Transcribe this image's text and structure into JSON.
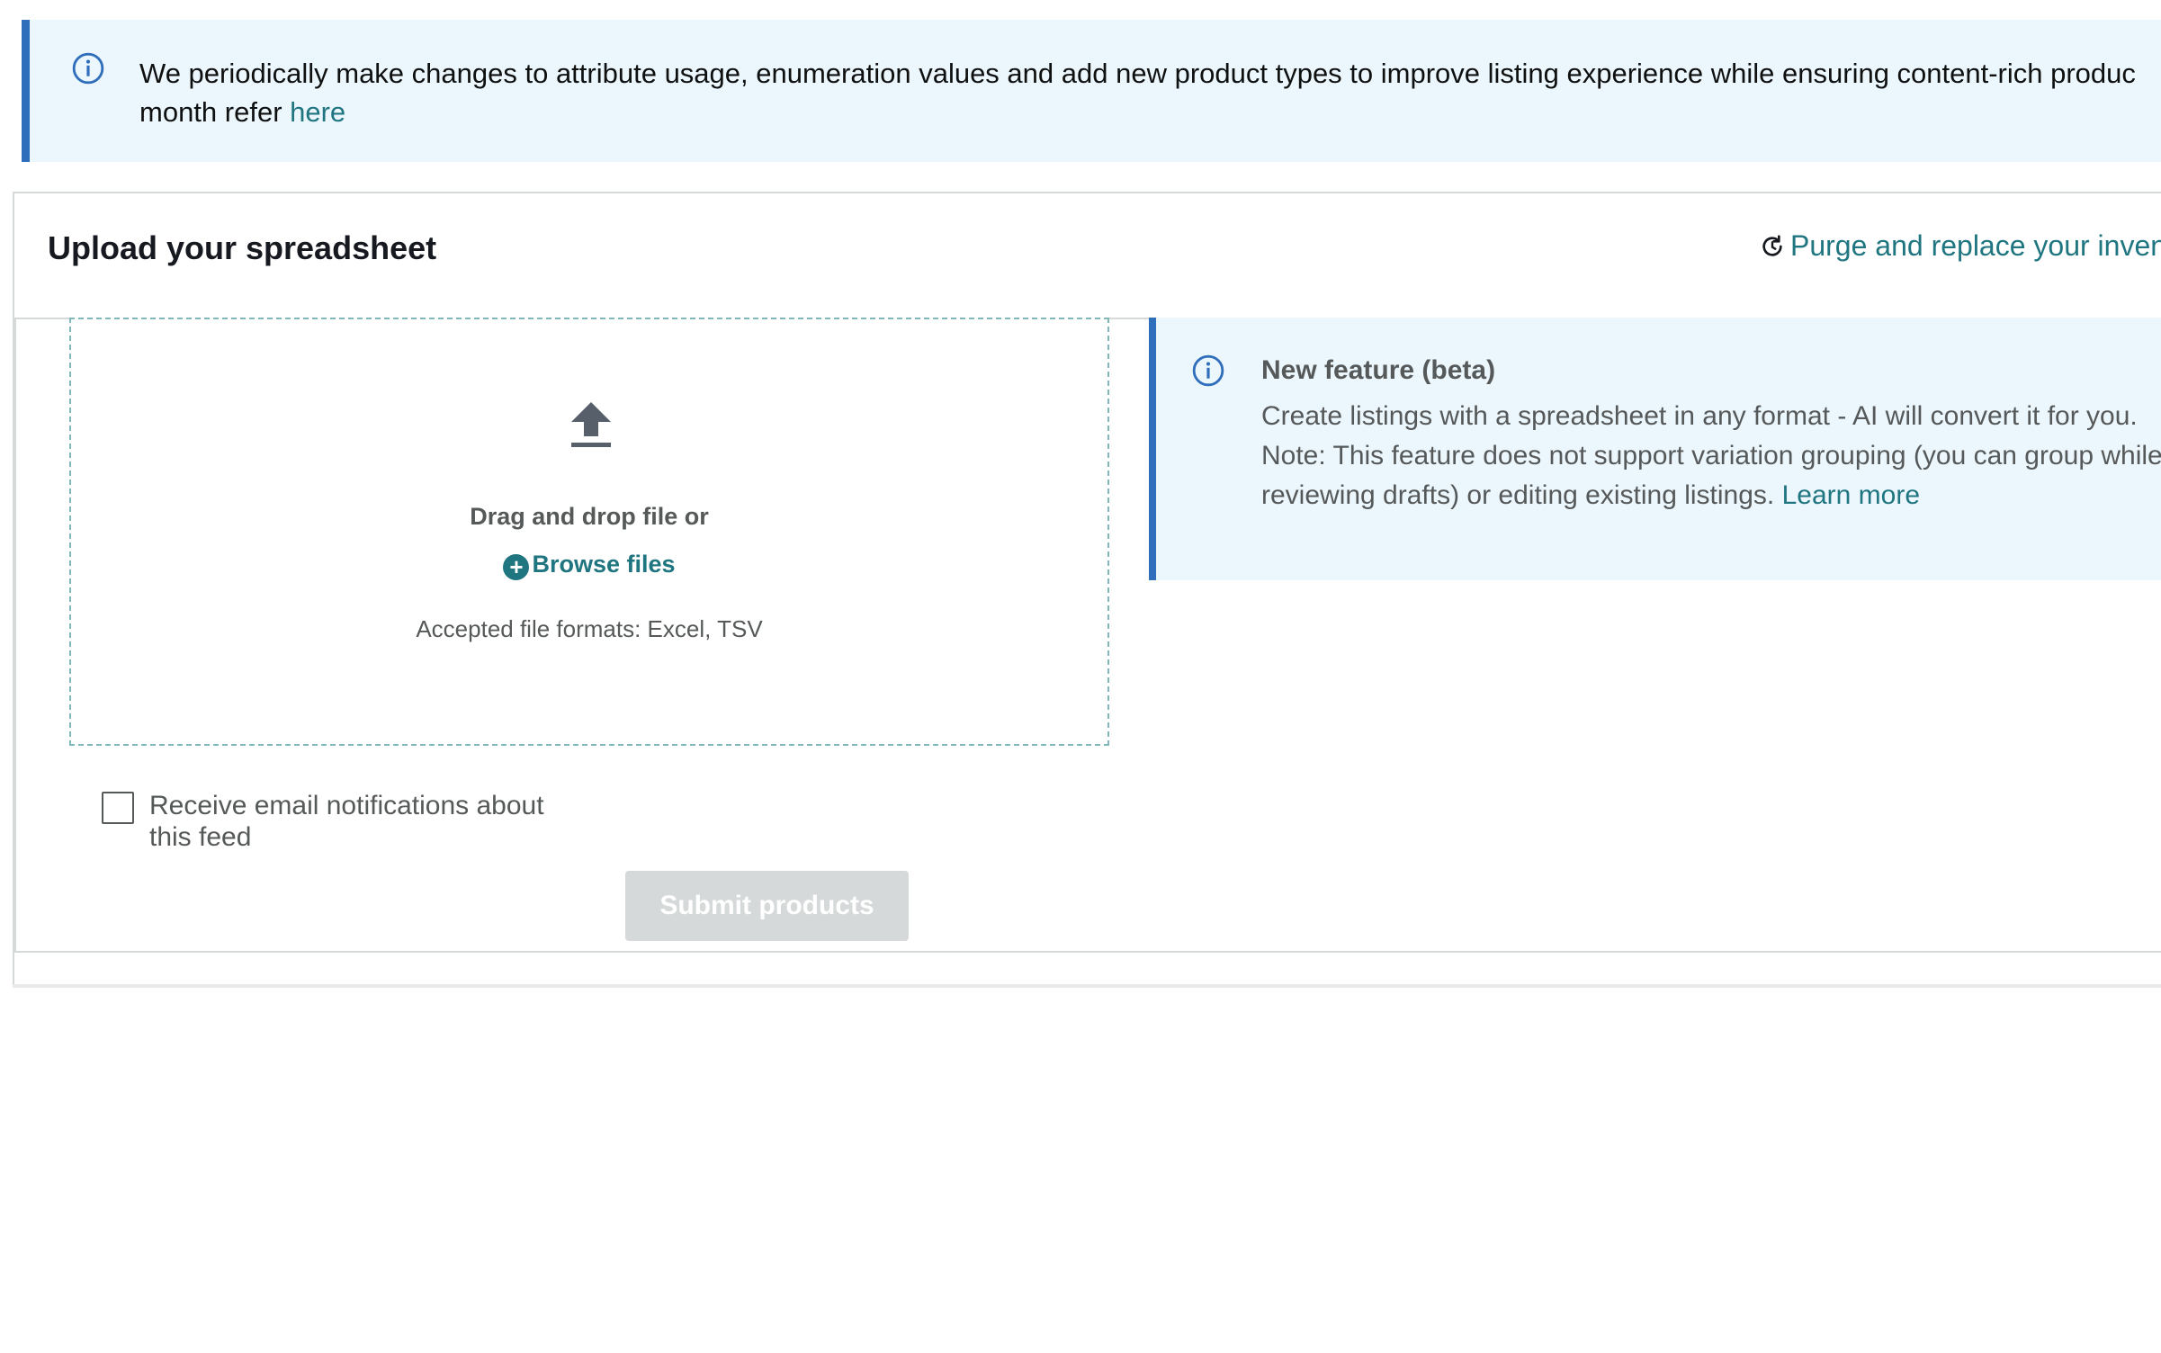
{
  "notice": {
    "text_line1": "We periodically make changes to attribute usage, enumeration values and add new product types to improve listing experience while ensuring content-rich produc",
    "text_line2": "month refer ",
    "link": "here",
    "icon": "info-icon"
  },
  "upload_card": {
    "title": "Upload your spreadsheet",
    "purge_link": "Purge and replace your invent",
    "purge_icon": "refresh-icon"
  },
  "dropzone": {
    "icon": "upload-icon",
    "drag_text": "Drag and drop file or",
    "browse_label": "Browse files",
    "browse_icon": "plus-circle-icon",
    "formats_text": "Accepted file formats: Excel, TSV"
  },
  "beta_panel": {
    "icon": "info-icon",
    "title": "New feature (beta)",
    "text": "Create listings with a spreadsheet in any format - AI will convert it for you. Note: This feature does not support variation grouping (you can group while reviewing drafts) or editing existing listings. ",
    "link": "Learn more"
  },
  "email_notifications": {
    "label": "Receive email notifications about this feed",
    "checked": false
  },
  "submit_button": {
    "label": "Submit products",
    "disabled": true
  },
  "colors": {
    "link": "#1f7580",
    "info_bg": "#ecf6fd",
    "info_border": "#2f6ebb",
    "disabled_bg": "#d5d9d9"
  }
}
